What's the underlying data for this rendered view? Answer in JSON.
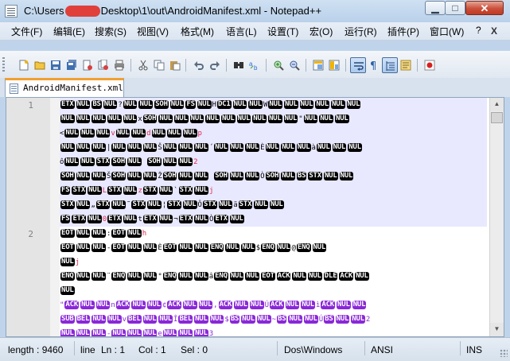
{
  "window": {
    "title_prefix": "C:\\Users",
    "title_suffix": "Desktop\\1\\out\\AndroidManifest.xml - Notepad++",
    "controls": {
      "minimize": "▁",
      "maximize": "□",
      "close": "✕"
    }
  },
  "menu": {
    "items": [
      "文件(F)",
      "编辑(E)",
      "搜索(S)",
      "视图(V)",
      "格式(M)",
      "语言(L)",
      "设置(T)",
      "宏(O)",
      "运行(R)",
      "插件(P)",
      "窗口(W)",
      "?"
    ],
    "close_glyph": "X"
  },
  "toolbar": {
    "buttons": [
      "new-file-icon",
      "open-file-icon",
      "save-icon",
      "save-all-icon",
      "close-icon",
      "close-all-icon",
      "print-icon",
      "cut-icon",
      "copy-icon",
      "paste-icon",
      "undo-icon",
      "redo-icon",
      "find-icon",
      "replace-icon",
      "zoom-in-icon",
      "zoom-out-icon",
      "sync-vertical-icon",
      "sync-horizontal-icon",
      "word-wrap-icon",
      "show-all-chars-icon",
      "indent-guide-icon",
      "doc-map-icon",
      "record-macro-icon"
    ]
  },
  "tab": {
    "label": "AndroidManifest.xml"
  },
  "editor": {
    "line_numbers": [
      {
        "number": "1"
      },
      {
        "number": "2"
      }
    ],
    "rows": [
      {
        "style": "plain",
        "tokens": [
          [
            "t",
            "ETX"
          ],
          [
            "t",
            "NUL"
          ],
          [
            "t",
            "BS"
          ],
          [
            "t",
            "NUL"
          ],
          [
            "s",
            "?"
          ],
          [
            "t",
            "NUL"
          ],
          [
            "t",
            "NUL"
          ],
          [
            "t",
            "SOH"
          ],
          [
            "t",
            "NUL"
          ],
          [
            "t",
            "FS"
          ],
          [
            "t",
            "NUL"
          ],
          [
            "s",
            "H"
          ],
          [
            "t",
            "DC1"
          ],
          [
            "t",
            "NUL"
          ],
          [
            "t",
            "NUL"
          ],
          [
            "s",
            "W"
          ],
          [
            "t",
            "NUL"
          ],
          [
            "t",
            "NUL"
          ],
          [
            "t",
            "NUL"
          ],
          [
            "t",
            "NUL"
          ],
          [
            "t",
            "NUL"
          ],
          [
            "t",
            "NUL"
          ]
        ]
      },
      {
        "style": "plain",
        "tokens": [
          [
            "t",
            "NUL"
          ],
          [
            "t",
            "NUL"
          ],
          [
            "t",
            "NUL"
          ],
          [
            "t",
            "NUL"
          ],
          [
            "t",
            "NUL"
          ],
          [
            "s",
            "x"
          ],
          [
            "t",
            "SOH"
          ],
          [
            "t",
            "NUL"
          ],
          [
            "t",
            "NUL"
          ],
          [
            "t",
            "NUL"
          ],
          [
            "t",
            "NUL"
          ],
          [
            "t",
            "NUL"
          ],
          [
            "t",
            "NUL"
          ],
          [
            "t",
            "NUL"
          ],
          [
            "t",
            "NUL"
          ],
          [
            "t",
            "NUL"
          ],
          [
            "s",
            "\""
          ],
          [
            "t",
            "NUL"
          ],
          [
            "t",
            "NUL"
          ],
          [
            "t",
            "NUL"
          ]
        ]
      },
      {
        "style": "plain",
        "tokens": [
          [
            "s",
            "<"
          ],
          [
            "t",
            "NUL"
          ],
          [
            "t",
            "NUL"
          ],
          [
            "t",
            "NUL"
          ],
          [
            "r",
            "v"
          ],
          [
            "t",
            "NUL"
          ],
          [
            "t",
            "NUL"
          ],
          [
            "r",
            "d"
          ],
          [
            "t",
            "NUL"
          ],
          [
            "t",
            "NUL"
          ],
          [
            "t",
            "NUL"
          ],
          [
            "r",
            "p"
          ]
        ]
      },
      {
        "style": "plain",
        "tokens": [
          [
            "t",
            "NUL"
          ],
          [
            "t",
            "NUL"
          ],
          [
            "t",
            "NUL"
          ],
          [
            "s",
            "|"
          ],
          [
            "t",
            "NUL"
          ],
          [
            "t",
            "NUL"
          ],
          [
            "t",
            "NUL"
          ],
          [
            "s",
            "Š"
          ],
          [
            "t",
            "NUL"
          ],
          [
            "t",
            "NUL"
          ],
          [
            "t",
            "NUL"
          ],
          [
            "s",
            "´"
          ],
          [
            "t",
            "NUL"
          ],
          [
            "t",
            "NUL"
          ],
          [
            "t",
            "NUL"
          ],
          [
            "s",
            "È"
          ],
          [
            "t",
            "NUL"
          ],
          [
            "t",
            "NUL"
          ],
          [
            "t",
            "NUL"
          ],
          [
            "s",
            "à"
          ],
          [
            "t",
            "NUL"
          ],
          [
            "t",
            "NUL"
          ],
          [
            "t",
            "NUL"
          ]
        ]
      },
      {
        "style": "plain",
        "tokens": [
          [
            "s",
            "ô"
          ],
          [
            "t",
            "NUL"
          ],
          [
            "t",
            "NUL"
          ],
          [
            "t",
            "STX"
          ],
          [
            "t",
            "SOH"
          ],
          [
            "t",
            "NUL"
          ],
          [
            "s",
            " "
          ],
          [
            "t",
            "SOH"
          ],
          [
            "t",
            "NUL"
          ],
          [
            "t",
            "NUL"
          ],
          [
            "r",
            "2"
          ]
        ]
      },
      {
        "style": "plain",
        "tokens": [
          [
            "t",
            "SOH"
          ],
          [
            "t",
            "NUL"
          ],
          [
            "t",
            "NUL"
          ],
          [
            "s",
            "Š"
          ],
          [
            "t",
            "SOH"
          ],
          [
            "t",
            "NUL"
          ],
          [
            "t",
            "NUL"
          ],
          [
            "s",
            "Ž"
          ],
          [
            "t",
            "SOH"
          ],
          [
            "t",
            "NUL"
          ],
          [
            "t",
            "NUL"
          ],
          [
            "s",
            " "
          ],
          [
            "t",
            "SOH"
          ],
          [
            "t",
            "NUL"
          ],
          [
            "t",
            "NUL"
          ],
          [
            "s",
            "Ò"
          ],
          [
            "t",
            "SOH"
          ],
          [
            "t",
            "NUL"
          ],
          [
            "t",
            "BS"
          ],
          [
            "t",
            "STX"
          ],
          [
            "t",
            "NUL"
          ],
          [
            "t",
            "NUL"
          ]
        ]
      },
      {
        "style": "plain",
        "tokens": [
          [
            "t",
            "FS"
          ],
          [
            "t",
            "STX"
          ],
          [
            "t",
            "NUL"
          ],
          [
            "r",
            "L"
          ],
          [
            "t",
            "STX"
          ],
          [
            "t",
            "NUL"
          ],
          [
            "r",
            "z"
          ],
          [
            "t",
            "STX"
          ],
          [
            "t",
            "NUL"
          ],
          [
            "s",
            "`"
          ],
          [
            "t",
            "STX"
          ],
          [
            "t",
            "NUL"
          ],
          [
            "r",
            "j"
          ]
        ]
      },
      {
        "style": "plain",
        "tokens": [
          [
            "t",
            "STX"
          ],
          [
            "t",
            "NUL"
          ],
          [
            "s",
            "„"
          ],
          [
            "t",
            "STX"
          ],
          [
            "t",
            "NUL"
          ],
          [
            "s",
            "˜"
          ],
          [
            "t",
            "STX"
          ],
          [
            "t",
            "NUL"
          ],
          [
            "s",
            "¦"
          ],
          [
            "t",
            "STX"
          ],
          [
            "t",
            "NUL"
          ],
          [
            "s",
            "Ô"
          ],
          [
            "t",
            "STX"
          ],
          [
            "t",
            "NUL"
          ],
          [
            "s",
            "ä"
          ],
          [
            "t",
            "STX"
          ],
          [
            "t",
            "NUL"
          ],
          [
            "t",
            "NUL"
          ]
        ]
      },
      {
        "style": "plain",
        "tokens": [
          [
            "t",
            "FS"
          ],
          [
            "t",
            "ETX"
          ],
          [
            "t",
            "NUL"
          ],
          [
            "r",
            "0"
          ],
          [
            "t",
            "ETX"
          ],
          [
            "t",
            "NUL"
          ],
          [
            "s",
            "t"
          ],
          [
            "t",
            "ETX"
          ],
          [
            "t",
            "NUL"
          ],
          [
            "s",
            "¬"
          ],
          [
            "t",
            "ETX"
          ],
          [
            "t",
            "NUL"
          ],
          [
            "s",
            "Ò"
          ],
          [
            "t",
            "ETX"
          ],
          [
            "t",
            "NUL"
          ]
        ]
      },
      {
        "style": "plain",
        "tokens": [
          [
            "t",
            "EOT"
          ],
          [
            "t",
            "NUL"
          ],
          [
            "t",
            "NUL"
          ],
          [
            "s",
            ":"
          ],
          [
            "t",
            "EOT"
          ],
          [
            "t",
            "NUL"
          ],
          [
            "r",
            "h"
          ]
        ]
      },
      {
        "style": "plain",
        "tokens": [
          [
            "t",
            "EOT"
          ],
          [
            "t",
            "NUL"
          ],
          [
            "t",
            "NUL"
          ],
          [
            "s",
            "-"
          ],
          [
            "t",
            "EOT"
          ],
          [
            "t",
            "NUL"
          ],
          [
            "t",
            "NUL"
          ],
          [
            "s",
            "È"
          ],
          [
            "t",
            "EOT"
          ],
          [
            "t",
            "NUL"
          ],
          [
            "t",
            "NUL"
          ],
          [
            "t",
            "ENQ"
          ],
          [
            "t",
            "NUL"
          ],
          [
            "t",
            "NUL"
          ],
          [
            "s",
            "$"
          ],
          [
            "t",
            "ENQ"
          ],
          [
            "t",
            "NUL"
          ],
          [
            "s",
            "@"
          ],
          [
            "t",
            "ENQ"
          ],
          [
            "t",
            "NUL"
          ]
        ]
      },
      {
        "style": "plain",
        "tokens": [
          [
            "t",
            "NUL"
          ],
          [
            "r",
            "j"
          ]
        ]
      },
      {
        "style": "plain",
        "tokens": [
          [
            "t",
            "ENQ"
          ],
          [
            "t",
            "NUL"
          ],
          [
            "t",
            "NUL"
          ],
          [
            "s",
            "¨"
          ],
          [
            "t",
            "ENQ"
          ],
          [
            "t",
            "NUL"
          ],
          [
            "t",
            "NUL"
          ],
          [
            "s",
            "°"
          ],
          [
            "t",
            "ENQ"
          ],
          [
            "t",
            "NUL"
          ],
          [
            "t",
            "NUL"
          ],
          [
            "s",
            "â"
          ],
          [
            "t",
            "ENQ"
          ],
          [
            "t",
            "NUL"
          ],
          [
            "t",
            "NUL"
          ],
          [
            "t",
            "EOT"
          ],
          [
            "t",
            "ACK"
          ],
          [
            "t",
            "NUL"
          ],
          [
            "t",
            "NUL"
          ],
          [
            "t",
            "DLE"
          ],
          [
            "t",
            "ACK"
          ],
          [
            "t",
            "NUL"
          ]
        ]
      },
      {
        "style": "plain",
        "tokens": [
          [
            "t",
            "NUL"
          ]
        ]
      },
      {
        "style": "purple",
        "tokens": [
          [
            "s",
            "\""
          ],
          [
            "t",
            "ACK"
          ],
          [
            "t",
            "NUL"
          ],
          [
            "t",
            "NUL"
          ],
          [
            "s",
            "n"
          ],
          [
            "t",
            "ACK"
          ],
          [
            "t",
            "NUL"
          ],
          [
            "t",
            "NUL"
          ],
          [
            "s",
            "¢"
          ],
          [
            "t",
            "ACK"
          ],
          [
            "t",
            "NUL"
          ],
          [
            "t",
            "NUL"
          ],
          [
            "s",
            ","
          ],
          [
            "t",
            "ACK"
          ],
          [
            "t",
            "NUL"
          ],
          [
            "t",
            "NUL"
          ],
          [
            "s",
            "Ú"
          ],
          [
            "t",
            "ACK"
          ],
          [
            "t",
            "NUL"
          ],
          [
            "t",
            "NUL"
          ],
          [
            "s",
            "ì"
          ],
          [
            "t",
            "ACK"
          ],
          [
            "t",
            "NUL"
          ],
          [
            "t",
            "NUL"
          ]
        ]
      },
      {
        "style": "purple",
        "tokens": [
          [
            "t",
            "SUB"
          ],
          [
            "t",
            "BEL"
          ],
          [
            "t",
            "NUL"
          ],
          [
            "t",
            "NUL"
          ],
          [
            "s",
            "v"
          ],
          [
            "t",
            "BEL"
          ],
          [
            "t",
            "NUL"
          ],
          [
            "t",
            "NUL"
          ],
          [
            "s",
            "Î"
          ],
          [
            "t",
            "BEL"
          ],
          [
            "t",
            "NUL"
          ],
          [
            "t",
            "NUL"
          ],
          [
            "s",
            "$"
          ],
          [
            "t",
            "BS"
          ],
          [
            "t",
            "NUL"
          ],
          [
            "t",
            "NUL"
          ],
          [
            "s",
            "~"
          ],
          [
            "t",
            "BS"
          ],
          [
            "t",
            "NUL"
          ],
          [
            "t",
            "NUL"
          ],
          [
            "s",
            "Ú"
          ],
          [
            "t",
            "BS"
          ],
          [
            "t",
            "NUL"
          ],
          [
            "t",
            "NUL"
          ],
          [
            "s",
            "2"
          ]
        ]
      },
      {
        "style": "purple",
        "tokens": [
          [
            "t",
            "NUL"
          ],
          [
            "t",
            "NUL"
          ],
          [
            "t",
            "NUL"
          ],
          [
            "s",
            "-"
          ],
          [
            "t",
            "NUL"
          ],
          [
            "t",
            "NUL"
          ],
          [
            "t",
            "NUL"
          ],
          [
            "s",
            "e"
          ],
          [
            "t",
            "NUL"
          ],
          [
            "t",
            "NUL"
          ],
          [
            "t",
            "NUL"
          ],
          [
            "s",
            "3"
          ]
        ]
      }
    ]
  },
  "status": {
    "length": "length : 9460",
    "lines": "line",
    "ln": "Ln : 1",
    "col": "Col : 1",
    "sel": "Sel : 0",
    "eol": "Dos\\Windows",
    "encoding": "ANSI",
    "mode": "INS"
  }
}
